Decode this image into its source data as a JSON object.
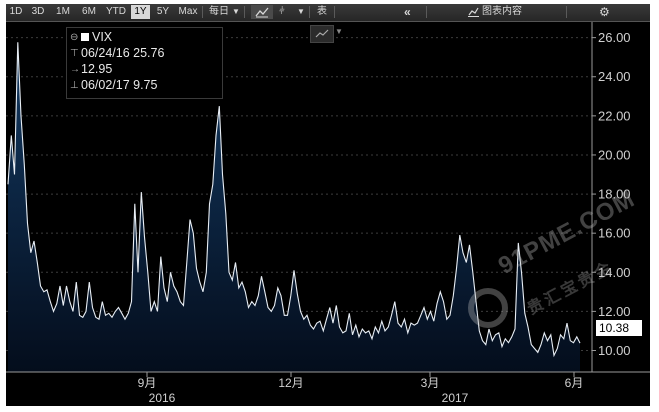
{
  "toolbar": {
    "ranges": [
      "1D",
      "3D",
      "1M",
      "6M",
      "YTD",
      "1Y",
      "5Y",
      "Max"
    ],
    "active_range": "1Y",
    "period_label": "每日",
    "table_label": "表",
    "chart_contents_label": "图表内容",
    "collapse_icon": "double-chevron-left-icon",
    "settings_icon": "gear-icon"
  },
  "legend": {
    "series_name": "VIX",
    "high_line": "06/24/16 25.76",
    "avg_line": "12.95",
    "low_line": "06/02/17 9.75"
  },
  "last_value_label": "10.38",
  "watermark": {
    "text": "91PME.COM",
    "chinese": "贵汇宝贵金"
  },
  "chart_data": {
    "type": "area",
    "series": [
      {
        "name": "VIX",
        "values": [
          18.5,
          21.0,
          19.0,
          25.76,
          22.0,
          19.5,
          16.5,
          15.0,
          15.6,
          14.5,
          13.3,
          13.0,
          13.1,
          12.5,
          12.0,
          12.4,
          13.3,
          12.3,
          13.3,
          12.5,
          12.0,
          13.5,
          11.8,
          11.7,
          12.0,
          13.5,
          12.2,
          11.7,
          11.6,
          12.5,
          11.8,
          11.9,
          11.7,
          12.0,
          12.2,
          11.9,
          11.6,
          11.9,
          12.5,
          17.5,
          14.0,
          18.1,
          15.8,
          14.0,
          12.0,
          12.5,
          12.0,
          14.8,
          13.2,
          12.5,
          14.0,
          13.3,
          13.0,
          12.5,
          12.3,
          14.5,
          16.7,
          16.0,
          14.2,
          13.5,
          13.0,
          14.0,
          17.5,
          18.5,
          21.0,
          22.5,
          19.0,
          17.0,
          14.0,
          13.6,
          14.5,
          13.2,
          13.5,
          13.0,
          12.2,
          12.5,
          12.3,
          12.8,
          13.8,
          13.0,
          12.2,
          12.0,
          12.3,
          13.2,
          12.8,
          11.8,
          11.8,
          12.8,
          14.1,
          12.9,
          12.0,
          11.6,
          11.8,
          11.3,
          11.1,
          11.4,
          11.5,
          11.0,
          11.6,
          12.2,
          11.4,
          12.3,
          11.2,
          10.9,
          11.0,
          11.9,
          10.8,
          11.3,
          10.7,
          11.1,
          10.9,
          11.0,
          10.6,
          11.2,
          10.9,
          11.5,
          11.0,
          11.2,
          11.8,
          12.5,
          11.4,
          11.2,
          11.6,
          10.9,
          11.4,
          11.3,
          11.4,
          11.8,
          12.2,
          11.6,
          12.0,
          11.5,
          12.4,
          13.0,
          12.5,
          11.6,
          11.8,
          12.8,
          14.2,
          15.9,
          15.0,
          14.5,
          15.4,
          14.0,
          12.5,
          11.0,
          10.5,
          10.3,
          11.1,
          10.5,
          10.8,
          10.9,
          10.2,
          10.6,
          10.4,
          10.7,
          11.1,
          15.5,
          14.0,
          11.9,
          11.2,
          10.3,
          10.1,
          9.9,
          10.3,
          10.9,
          10.5,
          10.8,
          9.75,
          10.1,
          10.8,
          10.6,
          11.4,
          10.5,
          10.4,
          10.7,
          10.38
        ]
      }
    ],
    "x_ticks": [
      "9月",
      "12月",
      "3月",
      "6月"
    ],
    "x_year_labels": [
      "2016",
      "2017"
    ],
    "y_ticks": [
      "10.00",
      "12.00",
      "14.00",
      "16.00",
      "18.00",
      "20.00",
      "22.00",
      "24.00",
      "26.00"
    ],
    "ylim": [
      8.9,
      26.8
    ],
    "grid": true,
    "colors": {
      "background": "#000000",
      "area_top": "#10365e",
      "area_bottom": "#040d1c",
      "line": "#e8eef5",
      "grid": "#3c3c3c",
      "axis_text": "#d0d0d0"
    }
  }
}
